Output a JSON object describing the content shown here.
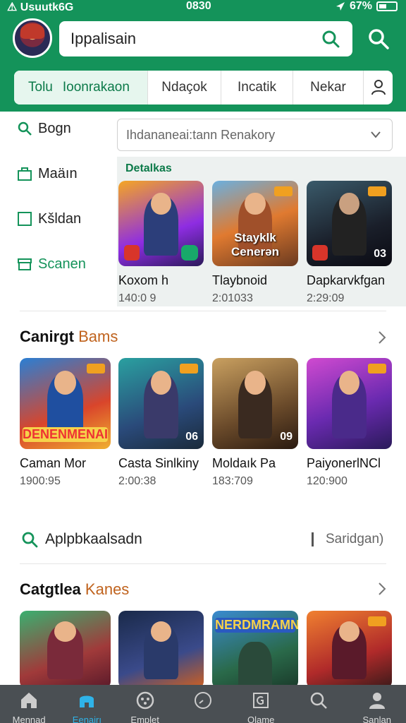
{
  "status_bar": {
    "carrier": "⚠ Usuutk6G",
    "time": "0830",
    "battery": "67%"
  },
  "header": {
    "search_value": "Ippalisain",
    "tabs": [
      {
        "label": "Tolu",
        "sub": "Ioonrakaon"
      },
      {
        "label": "Ndaçok"
      },
      {
        "label": "Incatik"
      },
      {
        "label": "Nekar"
      }
    ]
  },
  "sidebar": {
    "items": [
      {
        "label": "Bogn",
        "icon": "search-icon"
      },
      {
        "label": "Maäın",
        "icon": "bag-icon"
      },
      {
        "label": "Kšldan",
        "icon": "square-icon"
      },
      {
        "label": "Scanen",
        "icon": "archive-icon"
      }
    ]
  },
  "featured": {
    "filter_text": "Ihdananeai:tann Renakory",
    "title": "Detalkas",
    "cards": [
      {
        "title": "Koxom h",
        "sub": "140:0 9",
        "overlay": ""
      },
      {
        "title": "Tlaybnoid",
        "sub": "2:01033",
        "overlay": "Stayklk Cenerən"
      },
      {
        "title": "Dapkarvkfgan",
        "sub": "2:29:09",
        "overlay": "03"
      }
    ]
  },
  "section1": {
    "title_main": "Canirgt",
    "title_accent": "Bams",
    "cards": [
      {
        "title": "Caman Mor",
        "sub": "1900:95",
        "overlay": "DENENMENAI"
      },
      {
        "title": "Casta Sinlkiny",
        "sub": "2:00:38",
        "overlay": "06"
      },
      {
        "title": "Moldaık Pa",
        "sub": "183:709",
        "overlay": "09"
      },
      {
        "title": "PaiyonerlNCl",
        "sub": "120:900",
        "overlay": ""
      }
    ]
  },
  "search_row": {
    "text": "Aplpbkaalsadn",
    "alt": "Saridgan)"
  },
  "section2": {
    "title_main": "Catgtlea",
    "title_accent": "Kanes",
    "cards": [
      {
        "overlay": ""
      },
      {
        "overlay": ""
      },
      {
        "overlay": "NERDMRAMN"
      },
      {
        "overlay": ""
      }
    ]
  },
  "bottom_nav": [
    {
      "label": "Mennad",
      "icon": "home-icon"
    },
    {
      "label": "Eenairı",
      "icon": "store-icon"
    },
    {
      "label": "Emplet",
      "icon": "games-icon"
    },
    {
      "label": "",
      "icon": "compass-icon"
    },
    {
      "label": "Olame",
      "icon": "apps-icon"
    },
    {
      "label": "",
      "icon": "search-icon"
    },
    {
      "label": "Sanlan",
      "icon": "profile-icon"
    }
  ],
  "colors": {
    "brand_green": "#14935a",
    "accent_orange": "#c0631e",
    "nav_bg": "#4a4f53",
    "nav_active": "#2fb3e8"
  }
}
